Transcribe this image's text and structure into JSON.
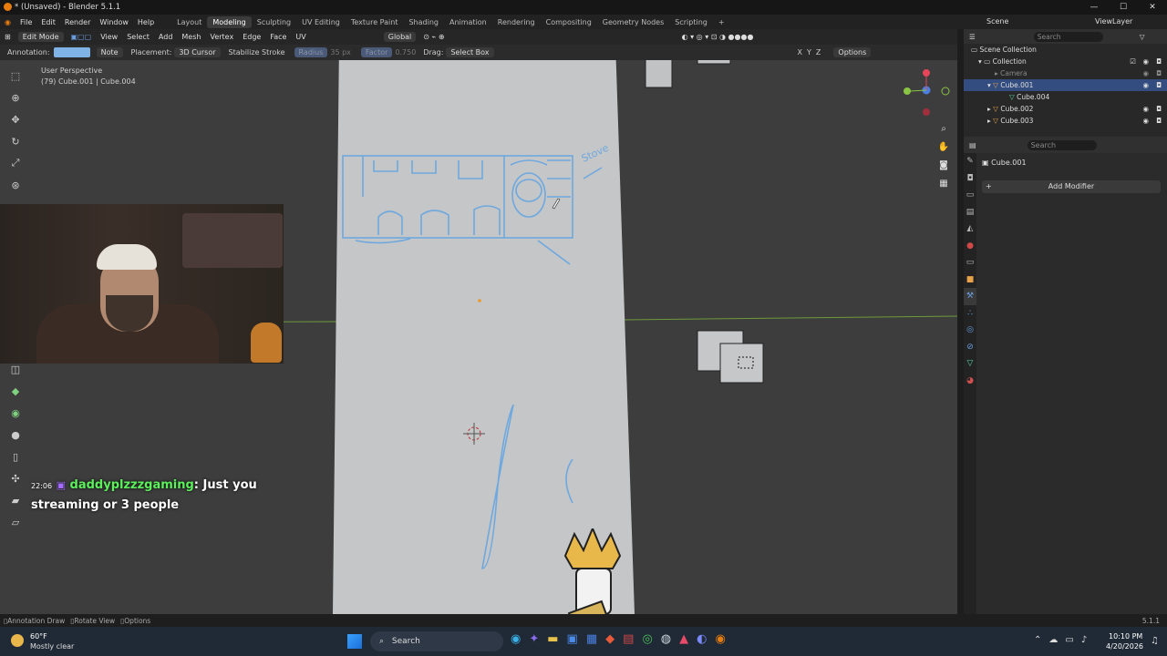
{
  "window": {
    "title": "* (Unsaved) - Blender 5.1.1",
    "controls": [
      "—",
      "☐",
      "✕"
    ]
  },
  "menu": [
    "File",
    "Edit",
    "Render",
    "Window",
    "Help"
  ],
  "workspaces": [
    "Layout",
    "Modeling",
    "Sculpting",
    "UV Editing",
    "Texture Paint",
    "Shading",
    "Animation",
    "Rendering",
    "Compositing",
    "Geometry Nodes",
    "Scripting",
    "+"
  ],
  "scene": {
    "label": "Scene",
    "view_layer": "ViewLayer"
  },
  "header": {
    "mode": "Edit Mode",
    "menus": [
      "View",
      "Select",
      "Add",
      "Mesh",
      "Vertex",
      "Edge",
      "Face",
      "UV"
    ],
    "orientation": "Global"
  },
  "toolsettings": {
    "annotation_label": "Annotation:",
    "annotation_color": "#7fb3e6",
    "note": "Note",
    "placement_label": "Placement:",
    "placement_value": "3D Cursor",
    "stabilize": "Stabilize Stroke",
    "radius_label": "Radius",
    "radius_value": "35 px",
    "factor_label": "Factor",
    "factor_value": "0.750",
    "drag_label": "Drag:",
    "drag_value": "Select Box",
    "options": "Options",
    "axes": [
      "X",
      "Y",
      "Z"
    ]
  },
  "viewport": {
    "perspective": "User Perspective",
    "object_info": "(79) Cube.001 | Cube.004",
    "sketch_label": "Stove"
  },
  "outliner": {
    "search_placeholder": "Search",
    "items": [
      {
        "name": "Scene Collection"
      },
      {
        "name": "Collection"
      },
      {
        "name": "Camera"
      },
      {
        "name": "Cube.001"
      },
      {
        "name": "Cube.004"
      },
      {
        "name": "Cube.002"
      },
      {
        "name": "Cube.003"
      }
    ]
  },
  "properties": {
    "search_placeholder": "Search",
    "object": "Cube.001",
    "add_modifier": "Add Modifier"
  },
  "chat": {
    "time": "22:06",
    "user": "daddyplzzzgaming",
    "message": ": Just you streaming or 3 people"
  },
  "statusbar": {
    "items": [
      "Annotation Draw",
      "Rotate View",
      "Options"
    ],
    "version": "5.1.1"
  },
  "taskbar": {
    "weather_temp": "60°F",
    "weather_desc": "Mostly clear",
    "search": "Search",
    "time": "10:10 PM",
    "date": "4/20/2026"
  },
  "colors": {
    "viewport_bg": "#3d3d3d",
    "plane": "#c4c6c8",
    "sketch": "#6fa8de",
    "selected_row": "#334d80",
    "chat_user": "#5cf05c"
  }
}
